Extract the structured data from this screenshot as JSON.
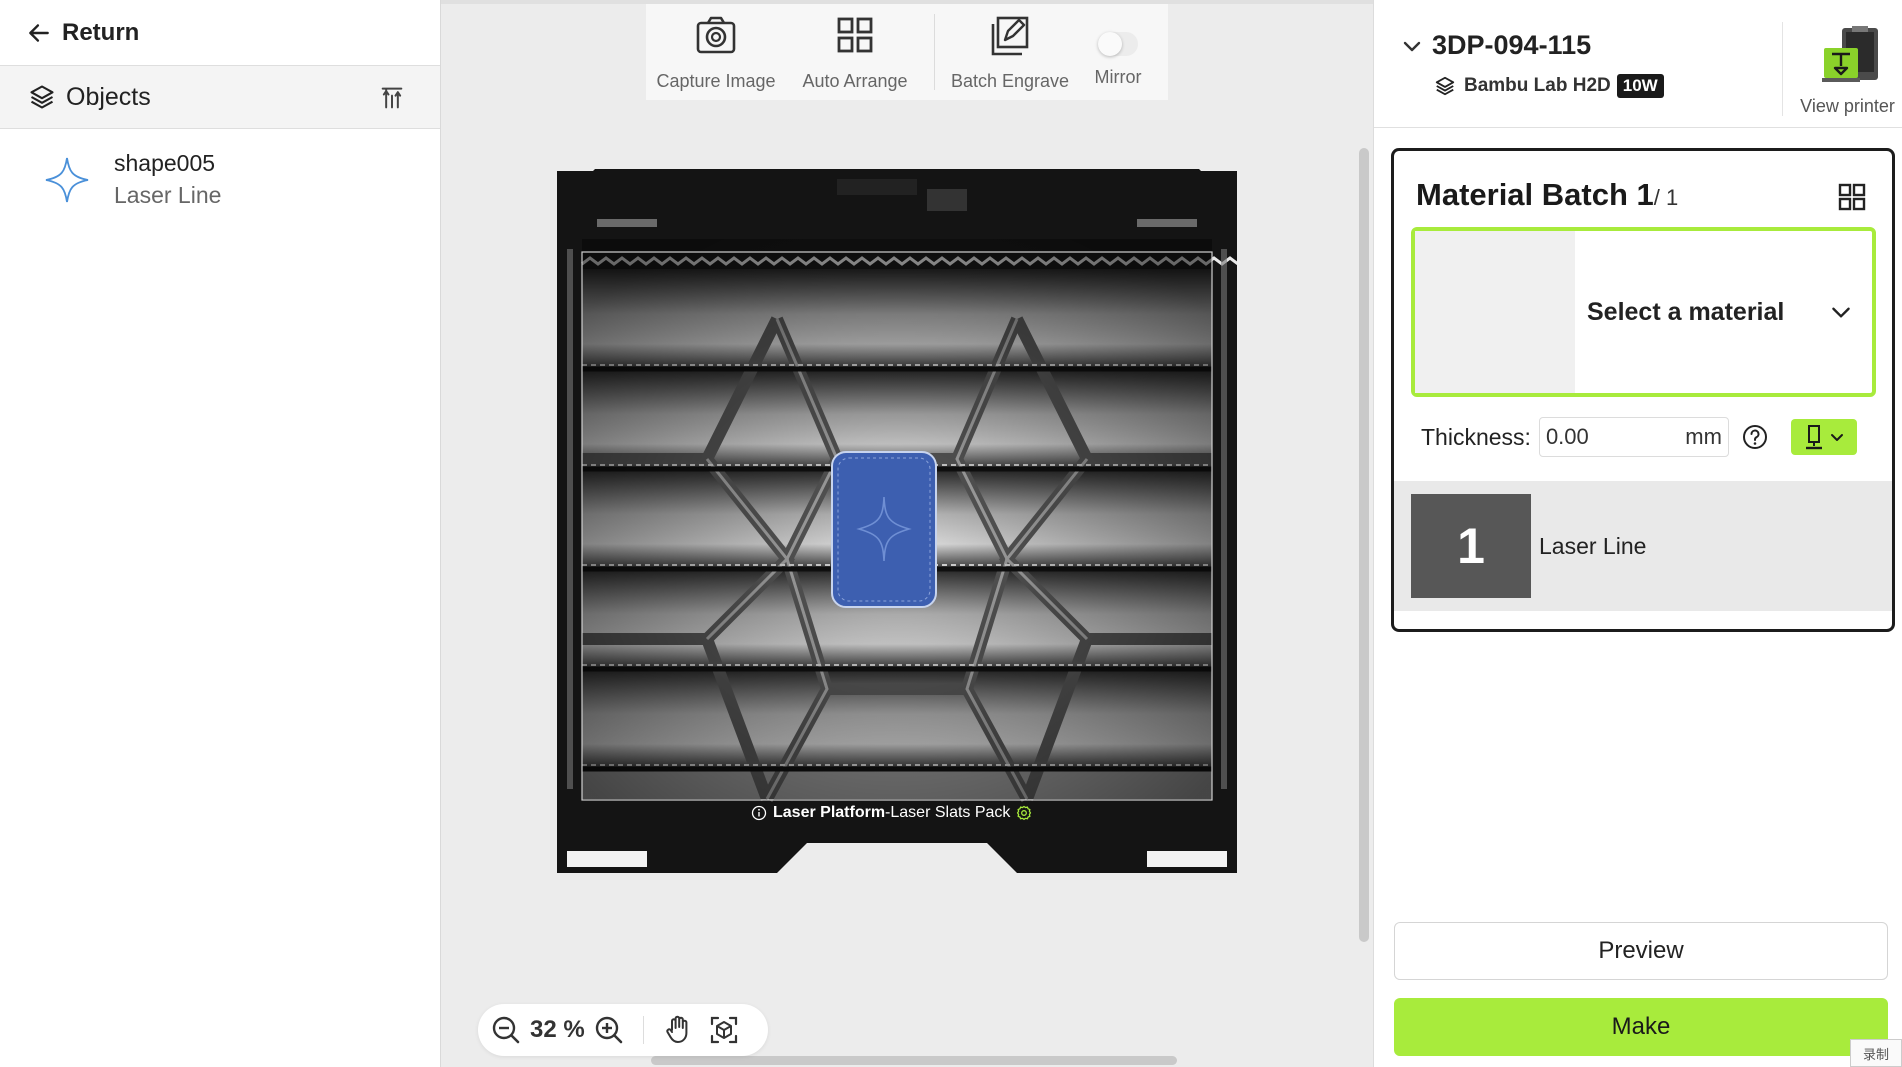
{
  "left_panel": {
    "return_label": "Return",
    "objects_label": "Objects",
    "objects": [
      {
        "name": "shape005",
        "type": "Laser Line"
      }
    ]
  },
  "toolbar": {
    "capture_label": "Capture Image",
    "arrange_label": "Auto Arrange",
    "batch_label": "Batch Engrave",
    "mirror_label": "Mirror",
    "mirror_on": false
  },
  "canvas": {
    "platform_name": "Laser Platform",
    "platform_sep": "-",
    "platform_pack": "Laser Slats Pack",
    "bed_brand": "Bambu Lab",
    "zoom_value": "32 %"
  },
  "right_panel": {
    "device_name": "3DP-094-115",
    "model_name": "Bambu Lab H2D",
    "model_badge": "10W",
    "view_printer_label": "View printer",
    "batch_title": "Material Batch 1",
    "batch_sub": "/ 1",
    "material_placeholder": "Select a material",
    "thickness_label": "Thickness:",
    "thickness_value": "0.00",
    "thickness_unit": "mm",
    "layer_number": "1",
    "layer_name": "Laser Line",
    "preview_label": "Preview",
    "make_label": "Make",
    "record_tag": "录制"
  },
  "colors": {
    "accent_green": "#a8eb3c",
    "object_blue": "#3d5fb0",
    "star_outline": "#4a90d9"
  },
  "icons": {
    "return": "arrow-left-icon",
    "objects": "layers-icon",
    "sort": "sort-icon",
    "capture": "camera-icon",
    "arrange": "grid-icon",
    "batch": "batch-engrave-icon",
    "zoom_out": "zoom-out-icon",
    "zoom_in": "zoom-in-icon",
    "pan": "hand-icon",
    "fit": "fit-view-icon",
    "help": "help-icon",
    "measure": "measure-icon"
  }
}
